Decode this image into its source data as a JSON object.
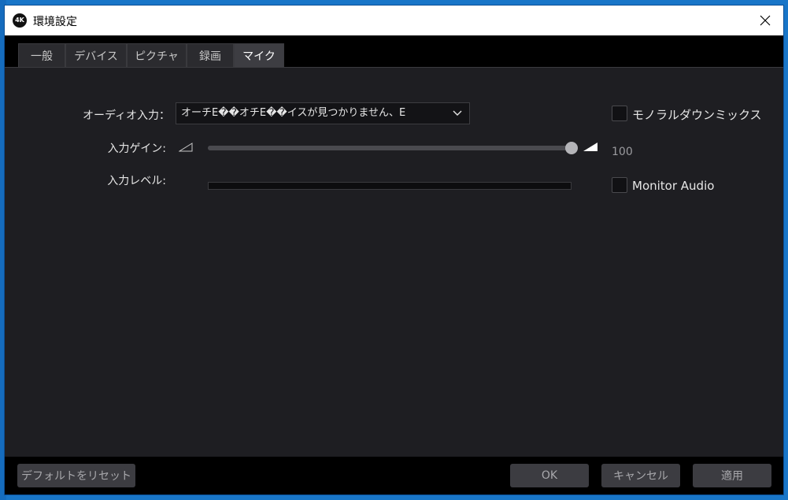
{
  "window": {
    "icon_text": "4K",
    "title": "環境設定"
  },
  "tabs": [
    {
      "label": "一般",
      "active": false
    },
    {
      "label": "デバイス",
      "active": false
    },
    {
      "label": "ピクチャ",
      "active": false
    },
    {
      "label": "録画",
      "active": false
    },
    {
      "label": "マイク",
      "active": true
    }
  ],
  "mic": {
    "audio_input_label": "オーディオ入力：",
    "audio_input_value": "オーチE��オチE��イスが見つかりません、E",
    "mono_downmix_label": "モノラルダウンミックス",
    "mono_downmix_checked": false,
    "input_gain_label": "入力ゲイン:",
    "input_gain_value": "100",
    "input_gain_percent": 100,
    "input_level_label": "入力レベル:",
    "input_level_percent": 0,
    "monitor_audio_label": "Monitor Audio",
    "monitor_audio_checked": false
  },
  "footer": {
    "reset_label": "デフォルトをリセット",
    "ok_label": "OK",
    "cancel_label": "キャンセル",
    "apply_label": "適用"
  },
  "colors": {
    "window_bg": "#1e1e22",
    "tabbar_bg": "#000000",
    "tab_active": "#3d3d42",
    "desktop": "#1976c8"
  }
}
